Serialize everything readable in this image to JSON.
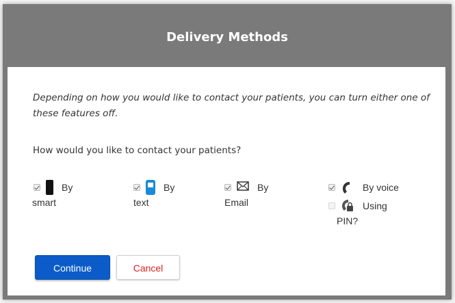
{
  "dialog": {
    "title": "Delivery Methods",
    "intro": "Depending on how you would like to contact your patients, you can turn either one of these features off.",
    "question": "How would you like to contact your patients?"
  },
  "methods": [
    {
      "icon": "smartphone-icon",
      "label_line1": "By",
      "label_line2": "smart",
      "checked": true
    },
    {
      "icon": "text-message-icon",
      "label_line1": "By",
      "label_line2": "text",
      "checked": true
    },
    {
      "icon": "envelope-icon",
      "label_line1": "By",
      "label_line2": "Email",
      "checked": true
    },
    {
      "icon": "phone-handset-icon",
      "label": "By voice",
      "checked": true
    },
    {
      "icon": "lock-phone-icon",
      "label_line1": "Using",
      "label_line2": "PIN?",
      "checked": false,
      "disabled": true
    }
  ],
  "buttons": {
    "continue": "Continue",
    "cancel": "Cancel"
  },
  "colors": {
    "header_bg": "#7a7a7a",
    "primary_button": "#0b5cc9",
    "cancel_text": "#e02020",
    "text_icon": "#1a8bd8"
  }
}
